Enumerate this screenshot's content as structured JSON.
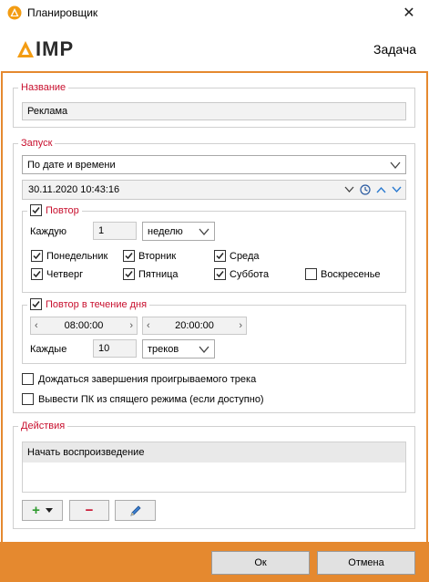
{
  "window": {
    "title": "Планировщик",
    "close_symbol": "✕"
  },
  "header": {
    "logo_text": "IMP",
    "title": "Задача"
  },
  "name_group": {
    "legend": "Название",
    "value": "Реклама"
  },
  "launch_group": {
    "legend": "Запуск",
    "mode": "По дате и времени",
    "datetime": "30.11.2020 10:43:16",
    "repeat": {
      "label": "Повтор",
      "checked": true,
      "every_label": "Каждую",
      "every_value": "1",
      "period": "неделю",
      "days": [
        {
          "label": "Понедельник",
          "checked": true
        },
        {
          "label": "Вторник",
          "checked": true
        },
        {
          "label": "Среда",
          "checked": true
        },
        {
          "label": "Четверг",
          "checked": true
        },
        {
          "label": "Пятница",
          "checked": true
        },
        {
          "label": "Суббота",
          "checked": true
        },
        {
          "label": "Воскресенье",
          "checked": false
        }
      ]
    },
    "daily_repeat": {
      "label": "Повтор в течение дня",
      "checked": true,
      "from_time": "08:00:00",
      "to_time": "20:00:00",
      "every_label": "Каждые",
      "every_value": "10",
      "unit": "треков"
    },
    "wait_finish": {
      "label": "Дождаться завершения проигрываемого трека",
      "checked": false
    },
    "wake_pc": {
      "label": "Вывести ПК из спящего режима (если доступно)",
      "checked": false
    }
  },
  "actions_group": {
    "legend": "Действия",
    "items": [
      "Начать воспроизведение"
    ],
    "add_symbol": "+",
    "remove_symbol": "−"
  },
  "footer": {
    "ok_label": "Ок",
    "cancel_label": "Отмена"
  },
  "colors": {
    "accent": "#e5892f",
    "legend": "#c8102e",
    "selected_row": "#e9e9e9"
  }
}
